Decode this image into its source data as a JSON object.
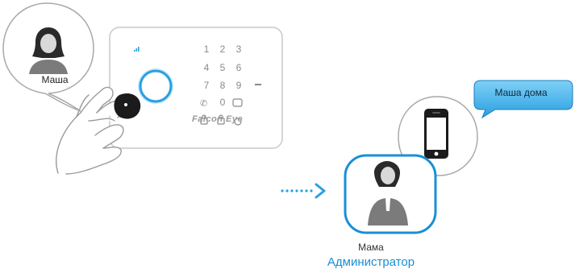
{
  "user_label": "Маша",
  "recipient_label": "Мама",
  "recipient_role": "Администратор",
  "notification_text": "Маша дома",
  "panel": {
    "brand": "Falcon Eye",
    "keys": [
      "1",
      "2",
      "3",
      "4",
      "5",
      "6",
      "7",
      "8",
      "9",
      "0"
    ],
    "accent": "#1a8fd4"
  },
  "icons": [
    "user-avatar-icon",
    "keyfob-icon",
    "hand-icon",
    "smartphone-icon",
    "arrow-icon"
  ]
}
